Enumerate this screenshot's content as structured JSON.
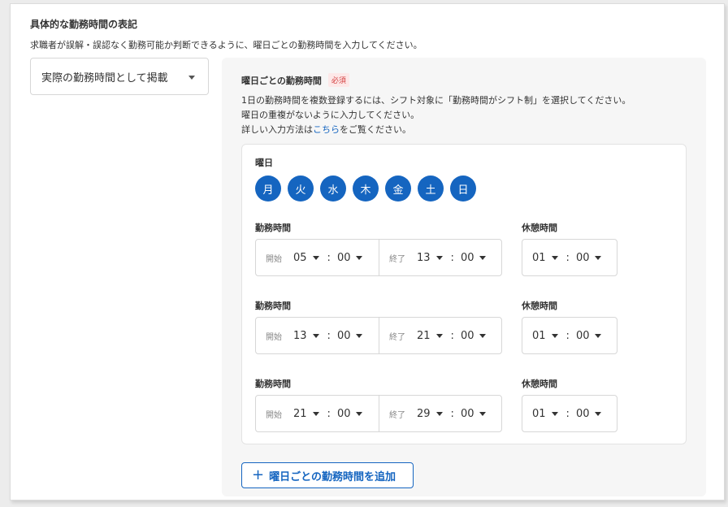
{
  "section": {
    "title": "具体的な勤務時間の表記",
    "description": "求職者が誤解・誤認なく勤務可能か判断できるように、曜日ごとの勤務時間を入力してください。"
  },
  "display_select": {
    "value": "実際の勤務時間として掲載"
  },
  "panel": {
    "title": "曜日ごとの勤務時間",
    "required_badge": "必須",
    "desc_line1": "1日の勤務時間を複数登録するには、シフト対象に「勤務時間がシフト制」を選択してください。",
    "desc_line2": "曜日の重複がないように入力してください。",
    "desc_line3_pre": "詳しい入力方法は",
    "desc_link": "こちら",
    "desc_line3_post": "をご覧ください。"
  },
  "days_label": "曜日",
  "days": [
    "月",
    "火",
    "水",
    "木",
    "金",
    "土",
    "日"
  ],
  "labels": {
    "work_time": "勤務時間",
    "break_time": "休憩時間",
    "start_prefix": "開始",
    "end_prefix": "終了",
    "colon": ":"
  },
  "schedules": [
    {
      "start_h": "05",
      "start_m": "00",
      "end_h": "13",
      "end_m": "00",
      "break_h": "01",
      "break_m": "00"
    },
    {
      "start_h": "13",
      "start_m": "00",
      "end_h": "21",
      "end_m": "00",
      "break_h": "01",
      "break_m": "00"
    },
    {
      "start_h": "21",
      "start_m": "00",
      "end_h": "29",
      "end_m": "00",
      "break_h": "01",
      "break_m": "00"
    }
  ],
  "add_button": {
    "icon": "plus-icon",
    "label": "曜日ごとの勤務時間を追加"
  },
  "colors": {
    "accent": "#1565c0",
    "required": "#d23b3b",
    "panel_bg": "#f6f6f6"
  }
}
